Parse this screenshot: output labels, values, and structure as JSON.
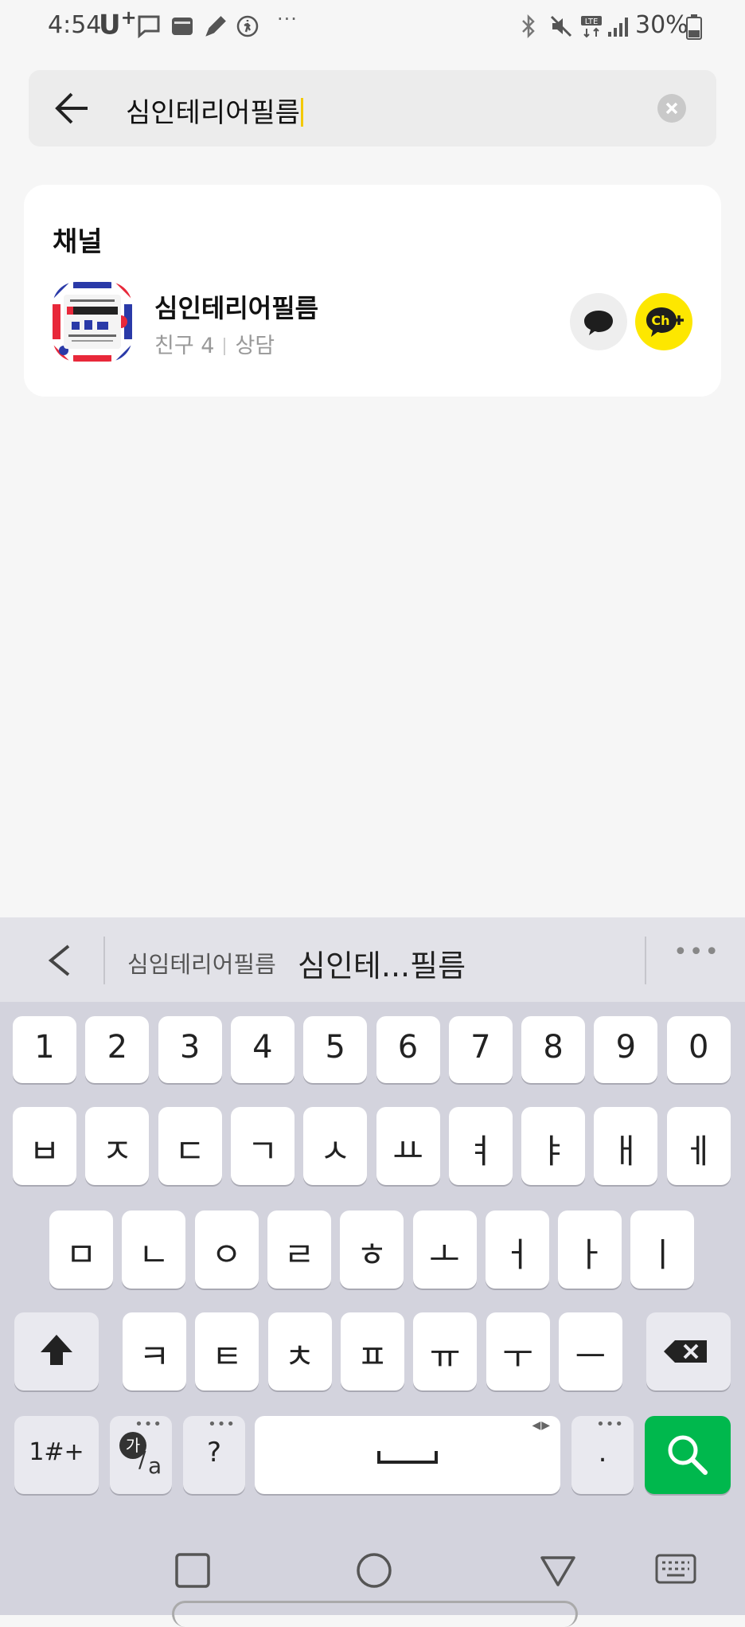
{
  "status_bar": {
    "time": "4:54",
    "carrier": "U",
    "carrier_sup": "+",
    "dots": "···",
    "battery_pct": "30%"
  },
  "search": {
    "query": "심인테리어필름"
  },
  "channel_section": {
    "title": "채널",
    "result": {
      "name": "심인테리어필름",
      "friends": "친구 4",
      "consult": "상담"
    }
  },
  "keyboard": {
    "suggestions": [
      "심임테리어필름",
      "심인테...필름"
    ],
    "more": "•••",
    "number_row": [
      "1",
      "2",
      "3",
      "4",
      "5",
      "6",
      "7",
      "8",
      "9",
      "0"
    ],
    "row1": [
      "ㅂ",
      "ㅈ",
      "ㄷ",
      "ㄱ",
      "ㅅ",
      "ㅛ",
      "ㅕ",
      "ㅑ",
      "ㅐ",
      "ㅔ"
    ],
    "row2": [
      "ㅁ",
      "ㄴ",
      "ㅇ",
      "ㄹ",
      "ㅎ",
      "ㅗ",
      "ㅓ",
      "ㅏ",
      "ㅣ"
    ],
    "row3": [
      "ㅋ",
      "ㅌ",
      "ㅊ",
      "ㅍ",
      "ㅠ",
      "ㅜ",
      "ㅡ"
    ],
    "symbols_label": "1#+",
    "lang_label_top": "가",
    "lang_label_bottom": "a",
    "question_label": "?",
    "period_label": ".",
    "key_more_dots": "•••",
    "space_arrows": "◀▶"
  },
  "colors": {
    "accent_yellow": "#fde700",
    "search_green": "#00b84d",
    "caret": "#f3c900"
  }
}
